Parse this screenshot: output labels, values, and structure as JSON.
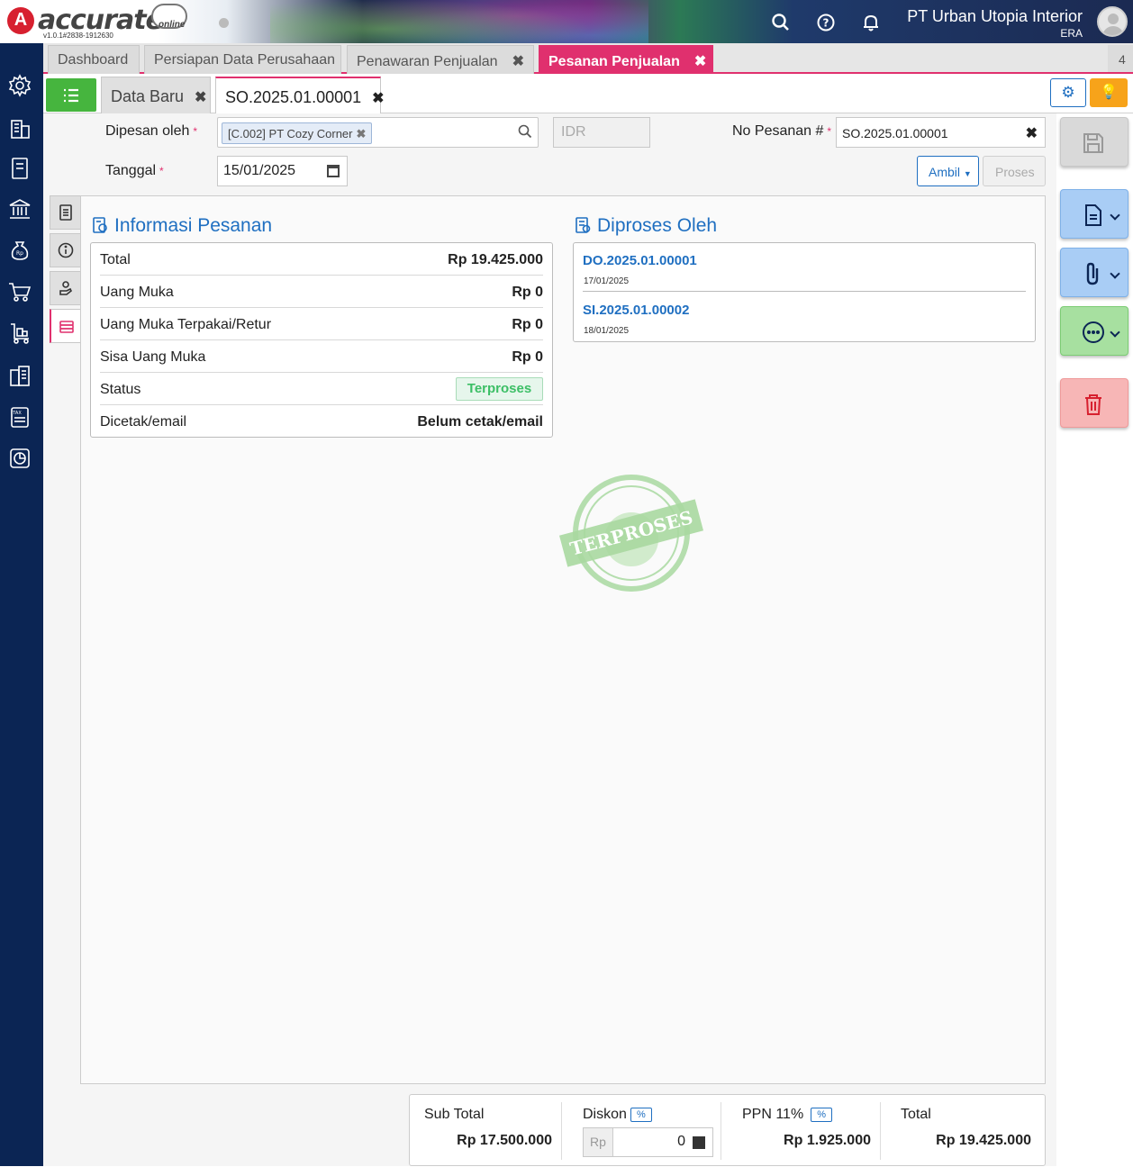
{
  "header": {
    "logo_text": "accurate",
    "logo_sub": "online",
    "version": "v1.0.1#2838-1912630",
    "company_name": "PT Urban Utopia Interior",
    "user_code": "ERA"
  },
  "module_tabs": [
    {
      "label": "Dashboard"
    },
    {
      "label": "Persiapan Data Perusahaan"
    },
    {
      "label": "Penawaran Penjualan"
    },
    {
      "label": "Pesanan Penjualan"
    }
  ],
  "tab_count": "4",
  "doc_tabs": [
    {
      "label": "Data Baru"
    },
    {
      "label": "SO.2025.01.00001"
    }
  ],
  "form": {
    "dipesan_label": "Dipesan oleh",
    "customer_tag": "[C.002] PT Cozy Corner",
    "currency_placeholder": "IDR",
    "no_pesanan_label": "No Pesanan #",
    "no_pesanan_value": "SO.2025.01.00001",
    "tanggal_label": "Tanggal",
    "tanggal_value": "15/01/2025",
    "ambil_label": "Ambil",
    "proses_label": "Proses"
  },
  "info": {
    "title": "Informasi Pesanan",
    "rows": [
      {
        "label": "Total",
        "value": "Rp 19.425.000"
      },
      {
        "label": "Uang Muka",
        "value": "Rp 0"
      },
      {
        "label": "Uang Muka Terpakai/Retur",
        "value": "Rp 0"
      },
      {
        "label": "Sisa Uang Muka",
        "value": "Rp 0"
      },
      {
        "label": "Status",
        "value": "Terproses"
      },
      {
        "label": "Dicetak/email",
        "value": "Belum cetak/email"
      }
    ]
  },
  "processed": {
    "title": "Diproses Oleh",
    "items": [
      {
        "number": "DO.2025.01.00001",
        "date": "17/01/2025"
      },
      {
        "number": "SI.2025.01.00002",
        "date": "18/01/2025"
      }
    ]
  },
  "stamp_text": "TERPROSES",
  "totals": {
    "subtotal_label": "Sub Total",
    "subtotal_value": "Rp 17.500.000",
    "diskon_label": "Diskon",
    "pct": "%",
    "diskon_currency": "Rp",
    "diskon_value": "0",
    "ppn_label": "PPN 11%",
    "ppn_value": "Rp 1.925.000",
    "total_label": "Total",
    "total_value": "Rp 19.425.000"
  },
  "colors": {
    "accent": "#e0306e",
    "primary": "#1f6fc1",
    "sidebar": "#0b2554",
    "success": "#46b53e",
    "warning": "#f7a31a"
  }
}
